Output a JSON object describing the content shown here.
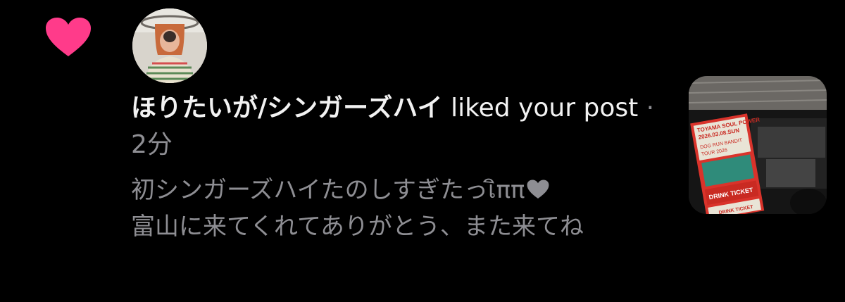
{
  "notification": {
    "icon": "heart-icon",
    "accent_color": "#ff3b8a",
    "username": "ほりたいが/シンガーズハイ",
    "action": " liked your post",
    "separator": " · ",
    "time": "2分",
    "comment_line1": "初シンガーズハイたのしすぎたっ",
    "comment_emoticon": "เิππ",
    "comment_rest": "富山に来てくれてありがとう、また来てね",
    "avatar": "user-avatar",
    "thumbnail": "post-thumbnail",
    "ticket_text": {
      "line1": "TOYAMA SOUL POWER",
      "line2": "2026.03.08.SUN",
      "line3": "DOG RUN BANDIT",
      "line4": "TOUR 2026",
      "line5": "DRINK TICKET",
      "line6": "DRINK TICKET"
    }
  }
}
